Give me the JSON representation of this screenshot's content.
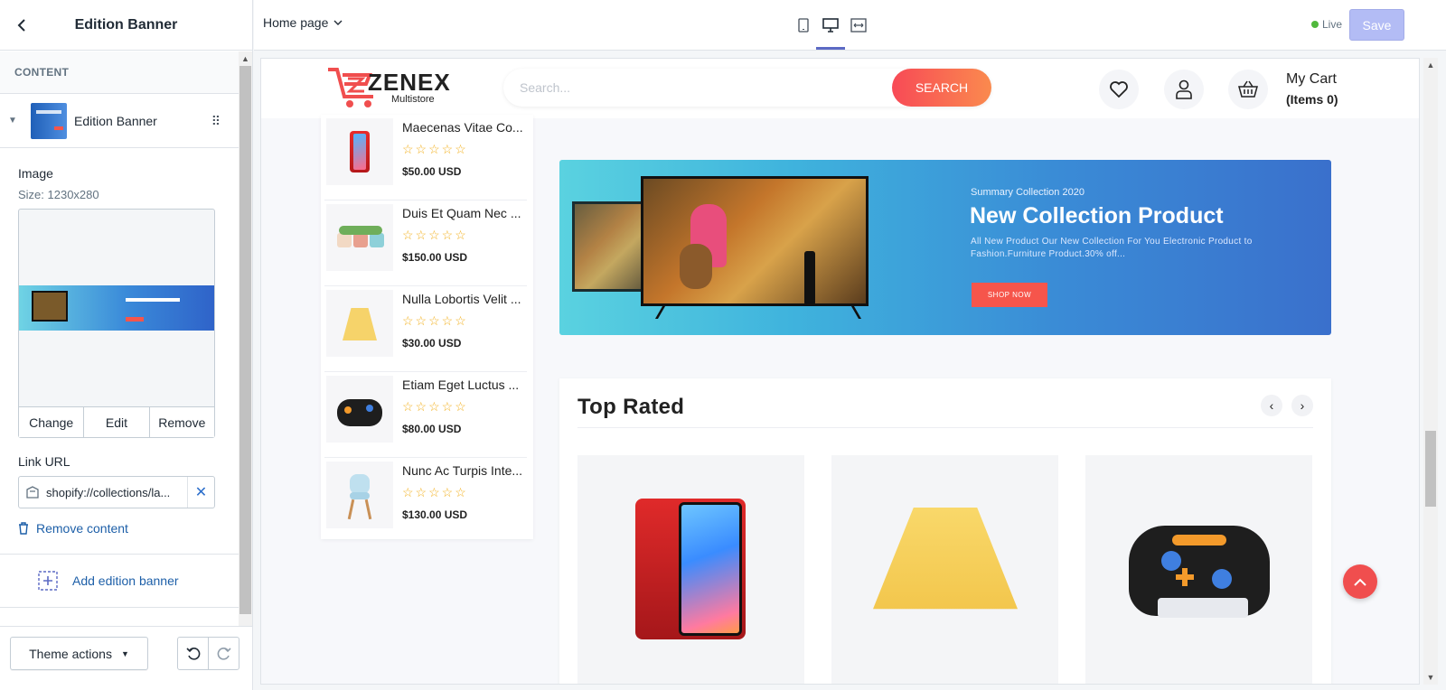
{
  "editor": {
    "title": "Edition Banner",
    "section_label": "CONTENT",
    "block": {
      "name": "Edition Banner"
    },
    "image": {
      "label": "Image",
      "size_hint": "Size: 1230x280",
      "actions": [
        "Change",
        "Edit",
        "Remove"
      ]
    },
    "link": {
      "label": "Link URL",
      "value": "shopify://collections/la..."
    },
    "remove_content": "Remove content",
    "add_block": "Add edition banner",
    "theme_actions": "Theme actions"
  },
  "topbar": {
    "page": "Home page",
    "status": "Live",
    "save": "Save"
  },
  "store": {
    "brand": "ZENEX",
    "brand_sub": "Multistore",
    "search_placeholder": "Search...",
    "search_button": "SEARCH",
    "cart_label": "My Cart",
    "cart_items": "(Items 0)",
    "side_products": [
      {
        "name": "Maecenas Vitae Co...",
        "price": "$50.00 USD",
        "rating": "☆☆☆☆☆"
      },
      {
        "name": "Duis Et Quam Nec ...",
        "price": "$150.00 USD",
        "rating": "☆☆☆☆☆"
      },
      {
        "name": "Nulla Lobortis Velit ...",
        "price": "$30.00 USD",
        "rating": "☆☆☆☆☆"
      },
      {
        "name": "Etiam Eget Luctus ...",
        "price": "$80.00 USD",
        "rating": "☆☆☆☆☆"
      },
      {
        "name": "Nunc Ac Turpis Inte...",
        "price": "$130.00 USD",
        "rating": "☆☆☆☆☆"
      }
    ],
    "banner": {
      "eyebrow": "Summary Collection 2020",
      "headline": "New Collection Product",
      "description": "All New Product Our New Collection For You Electronic Product to Fashion.Furniture Product.30% off...",
      "cta": "SHOP NOW"
    },
    "top_rated": {
      "title": "Top Rated",
      "prev": "‹",
      "next": "›"
    }
  },
  "colors": {
    "accent": "#5c6ac4",
    "link": "#1d5fa8",
    "brand_red": "#f6554b",
    "live_green": "#50b83c",
    "star": "#f2b01e"
  },
  "icons": [
    "chevron-left-icon",
    "caret-down-icon",
    "drag-handle-icon",
    "link-icon",
    "close-icon",
    "trash-icon",
    "add-block-icon",
    "undo-icon",
    "redo-icon",
    "mobile-icon",
    "desktop-icon",
    "fullwidth-icon",
    "heart-icon",
    "user-icon",
    "basket-icon",
    "arrow-up-icon"
  ]
}
